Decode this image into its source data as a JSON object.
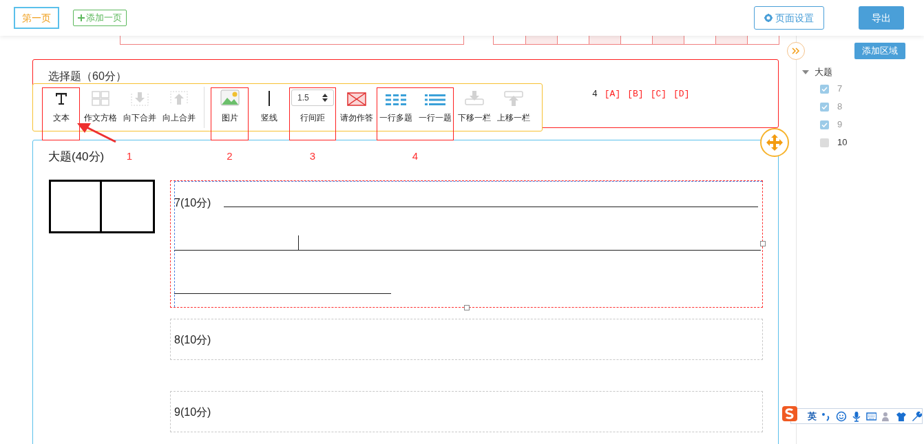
{
  "header": {
    "pages": [
      {
        "label": "第一页",
        "selected": true
      }
    ],
    "add_page": "添加一页",
    "page_settings": "页面设置",
    "export": "导出"
  },
  "choice_section": {
    "title": "选择题（60分）",
    "question_number": "4",
    "options": [
      "[A]",
      "[B]",
      "[C]",
      "[D]"
    ]
  },
  "toolbar": {
    "groups": [
      {
        "annotation": "1",
        "arrow": true,
        "items": [
          {
            "label": "文本",
            "disabled": false
          }
        ]
      },
      {
        "items": [
          {
            "label": "作文方格",
            "disabled": true
          },
          {
            "label": "向下合并",
            "disabled": true
          },
          {
            "label": "向上合并",
            "disabled": true
          }
        ]
      },
      {
        "kind": "separator"
      },
      {
        "annotation": "2",
        "items": [
          {
            "label": "图片",
            "disabled": false
          }
        ]
      },
      {
        "items": [
          {
            "label": "竖线",
            "disabled": false
          }
        ]
      },
      {
        "annotation": "3",
        "items": [
          {
            "label": "行间距",
            "kind": "spinner",
            "value": "1.5",
            "disabled": false
          }
        ]
      },
      {
        "items": [
          {
            "label": "请勿作答",
            "disabled": false
          }
        ]
      },
      {
        "annotation": "4",
        "items": [
          {
            "label": "一行多题",
            "disabled": false
          },
          {
            "label": "一行一题",
            "disabled": false
          }
        ]
      },
      {
        "items": [
          {
            "label": "下移一栏",
            "disabled": true
          },
          {
            "label": "上移一栏",
            "disabled": true
          }
        ]
      }
    ]
  },
  "big_section": {
    "title": "大题(40分)",
    "questions": [
      {
        "label": "7(10分)",
        "selected": true,
        "answer_lines": true
      },
      {
        "label": "8(10分)",
        "selected": false,
        "answer_lines": false
      },
      {
        "label": "9(10分)",
        "selected": false,
        "answer_lines": false
      }
    ]
  },
  "sidebar": {
    "add_area": "添加区域",
    "tree": [
      {
        "label": "大题",
        "expanded": true,
        "children": [
          {
            "label": "7",
            "checked": true
          },
          {
            "label": "8",
            "checked": true
          },
          {
            "label": "9",
            "checked": true
          },
          {
            "label": "10",
            "checked": false
          }
        ]
      }
    ]
  },
  "ime_toolbar": {
    "mode": "英"
  }
}
